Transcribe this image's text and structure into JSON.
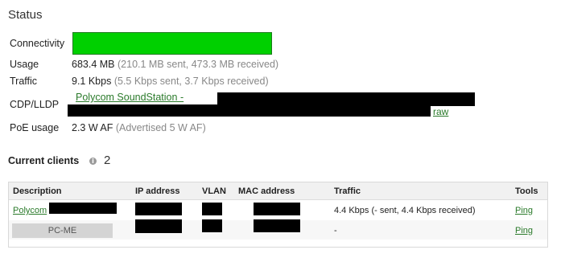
{
  "status": {
    "title": "Status",
    "rows": {
      "connectivity": {
        "label": "Connectivity"
      },
      "usage": {
        "label": "Usage",
        "value": "683.4 MB",
        "detail": "(210.1 MB sent, 473.3 MB received)"
      },
      "traffic": {
        "label": "Traffic",
        "value": "9.1 Kbps",
        "detail": "(5.5 Kbps sent, 3.7 Kbps received)"
      },
      "cdp_lldp": {
        "label": "CDP/LLDP",
        "link": "Polycom SoundStation -",
        "raw": "raw"
      },
      "poe": {
        "label": "PoE usage",
        "value": "2.3 W AF",
        "detail": "(Advertised 5 W AF)"
      }
    },
    "colors": {
      "connectivity_ok": "#00d000",
      "link": "#2a7a2a"
    }
  },
  "clients": {
    "title": "Current clients",
    "count": "2",
    "columns": {
      "description": "Description",
      "ip": "IP address",
      "vlan": "VLAN",
      "mac": "MAC address",
      "traffic": "Traffic",
      "tools": "Tools"
    },
    "rows": [
      {
        "description": "Polycom",
        "traffic": "4.4 Kbps (- sent, 4.4 Kbps received)",
        "tool": "Ping"
      },
      {
        "description": "PC-ME",
        "traffic": "-",
        "tool": "Ping"
      }
    ]
  }
}
